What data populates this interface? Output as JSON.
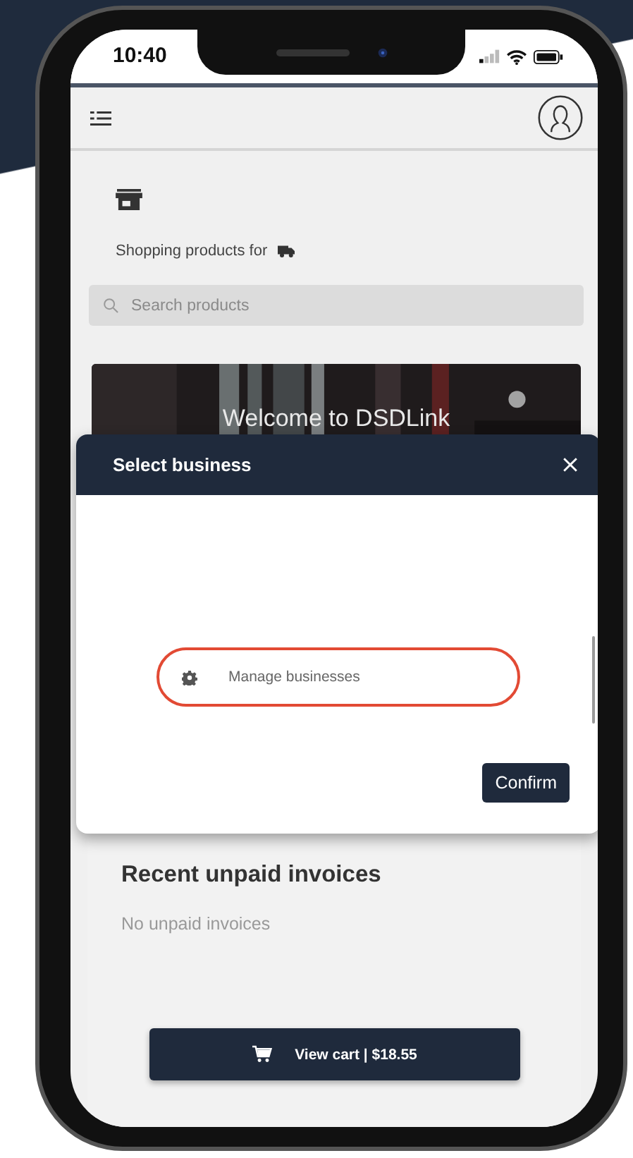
{
  "status_bar": {
    "time": "10:40"
  },
  "shop": {
    "caption": "Shopping products for"
  },
  "search": {
    "placeholder": "Search products"
  },
  "banner": {
    "title": "Welcome to DSDLink"
  },
  "modal": {
    "title": "Select business",
    "items": [
      {
        "label": "Manage businesses",
        "highlighted": true
      }
    ],
    "confirm": "Confirm"
  },
  "invoices": {
    "title": "Recent unpaid invoices",
    "empty": "No unpaid invoices"
  },
  "cart_button": {
    "label": "View cart | $18.55"
  }
}
